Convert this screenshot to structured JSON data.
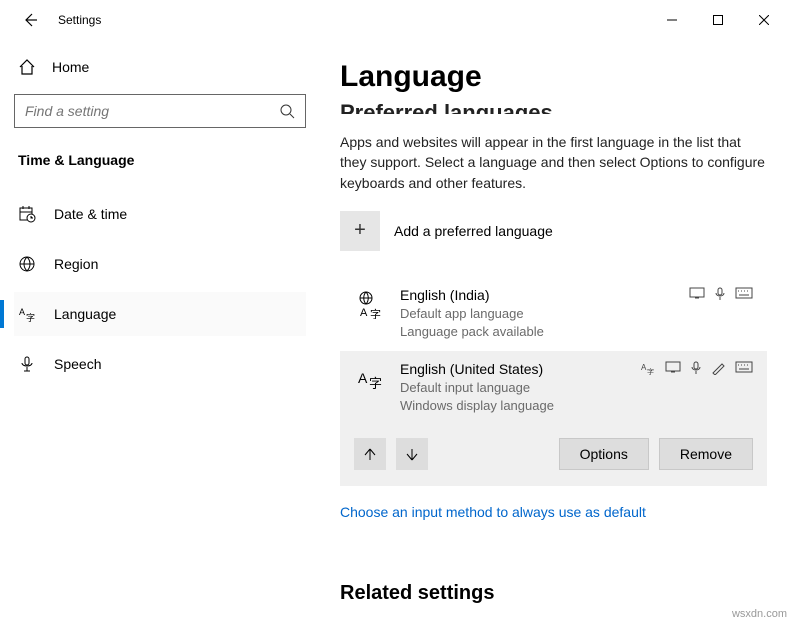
{
  "titlebar": {
    "title": "Settings"
  },
  "sidebar": {
    "home": "Home",
    "search_placeholder": "Find a setting",
    "section": "Time & Language",
    "items": [
      {
        "label": "Date & time"
      },
      {
        "label": "Region"
      },
      {
        "label": "Language"
      },
      {
        "label": "Speech"
      }
    ]
  },
  "main": {
    "title": "Language",
    "truncated_heading": "Preferred languages",
    "description": "Apps and websites will appear in the first language in the list that they support. Select a language and then select Options to configure keyboards and other features.",
    "add_label": "Add a preferred language",
    "languages": [
      {
        "name": "English (India)",
        "sub1": "Default app language",
        "sub2": "Language pack available"
      },
      {
        "name": "English (United States)",
        "sub1": "Default input language",
        "sub2": "Windows display language"
      }
    ],
    "options_btn": "Options",
    "remove_btn": "Remove",
    "link": "Choose an input method to always use as default",
    "related": "Related settings"
  },
  "watermark": "wsxdn.com"
}
